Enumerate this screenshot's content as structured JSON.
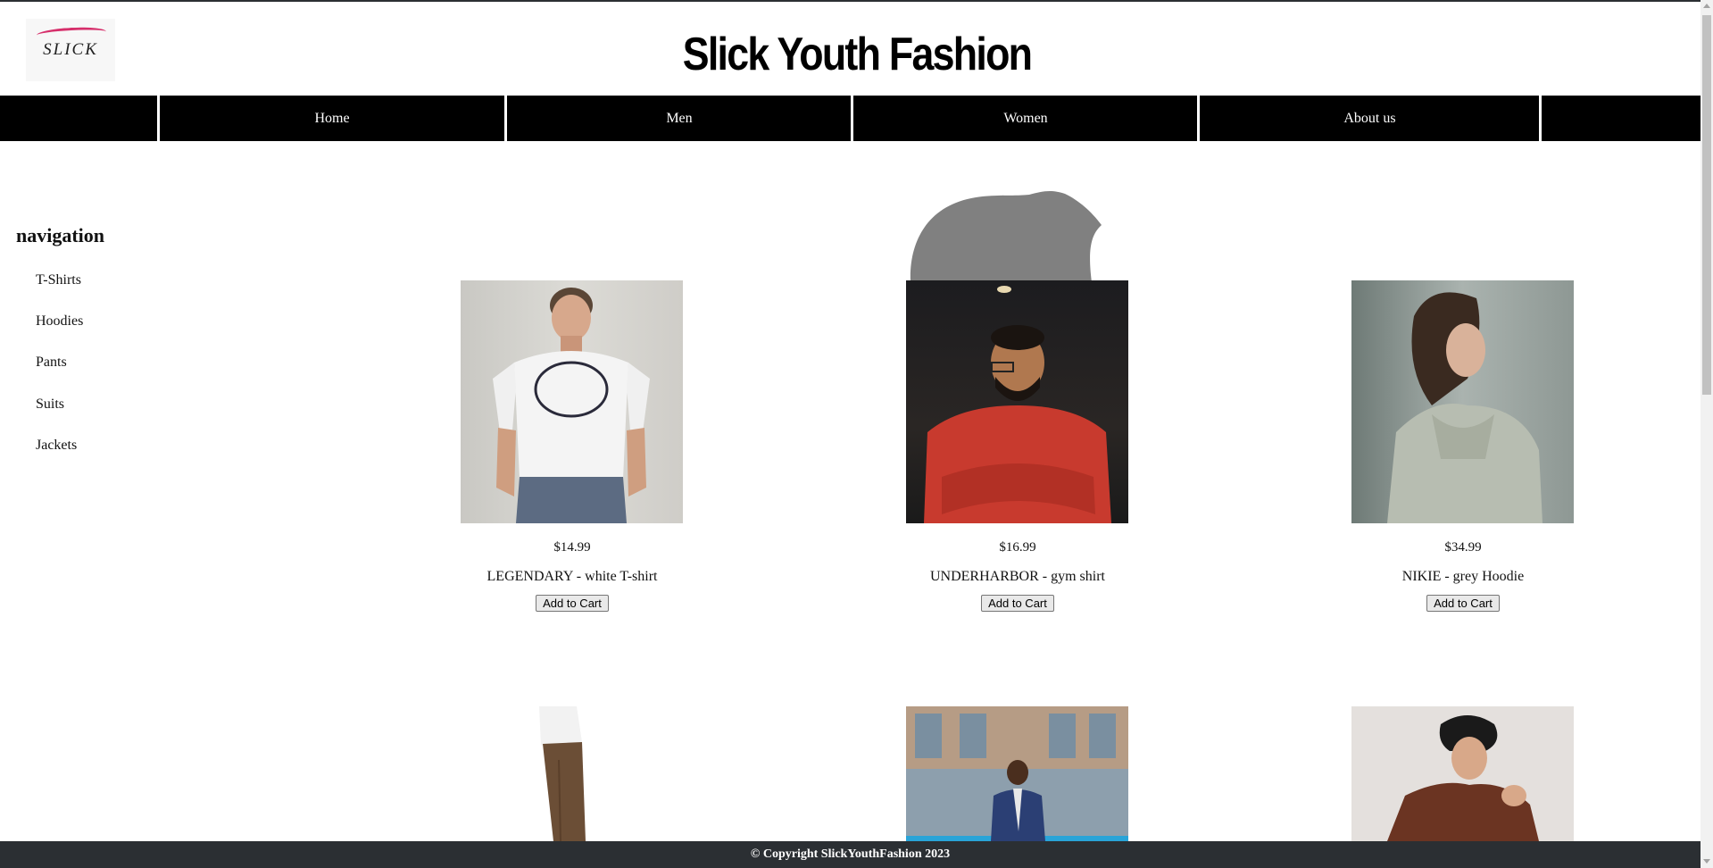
{
  "header": {
    "logo_text": "SLICK",
    "title": "Slick Youth Fashion"
  },
  "nav": {
    "items": [
      {
        "label": "Home"
      },
      {
        "label": "Men"
      },
      {
        "label": "Women"
      },
      {
        "label": "About us"
      }
    ]
  },
  "sidebar": {
    "title": "navigation",
    "links": [
      {
        "label": "T-Shirts"
      },
      {
        "label": "Hoodies"
      },
      {
        "label": "Pants"
      },
      {
        "label": "Suits"
      },
      {
        "label": "Jackets"
      }
    ]
  },
  "products": [
    {
      "price": "$14.99",
      "name": "LEGENDARY - white T-shirt",
      "button": "Add to Cart"
    },
    {
      "price": "$16.99",
      "name": "UNDERHARBOR - gym shirt",
      "button": "Add to Cart"
    },
    {
      "price": "$34.99",
      "name": "NIKIE - grey Hoodie",
      "button": "Add to Cart"
    }
  ],
  "footer": {
    "text": "© Copyright SlickYouthFashion 2023"
  },
  "colors": {
    "navbar": "#000000",
    "footer": "#2b2f33",
    "logo_accent": "#d62f6b"
  }
}
